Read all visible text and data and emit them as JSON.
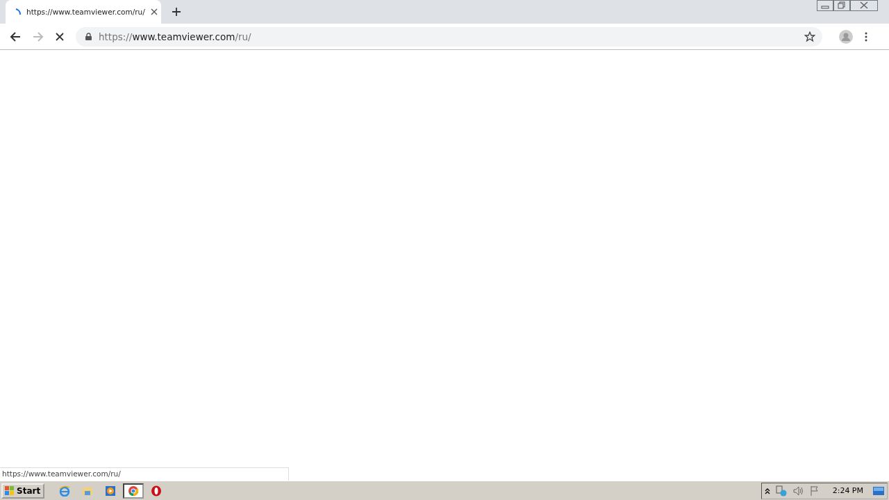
{
  "tabs": [
    {
      "title": "https://www.teamviewer.com/ru/",
      "selected": true,
      "loading": true
    }
  ],
  "address_bar": {
    "scheme": "https://",
    "host": "www.teamviewer.com",
    "path": "/ru/"
  },
  "page_loading": true,
  "status_bubble": "https://www.teamviewer.com/ru/",
  "taskbar": {
    "start": "Start",
    "apps": [
      {
        "kind": "ie",
        "selected": false
      },
      {
        "kind": "explorer",
        "selected": false
      },
      {
        "kind": "media",
        "selected": false
      },
      {
        "kind": "chrome",
        "selected": true
      },
      {
        "kind": "opera",
        "selected": false
      }
    ],
    "clock": "2:24 PM"
  }
}
